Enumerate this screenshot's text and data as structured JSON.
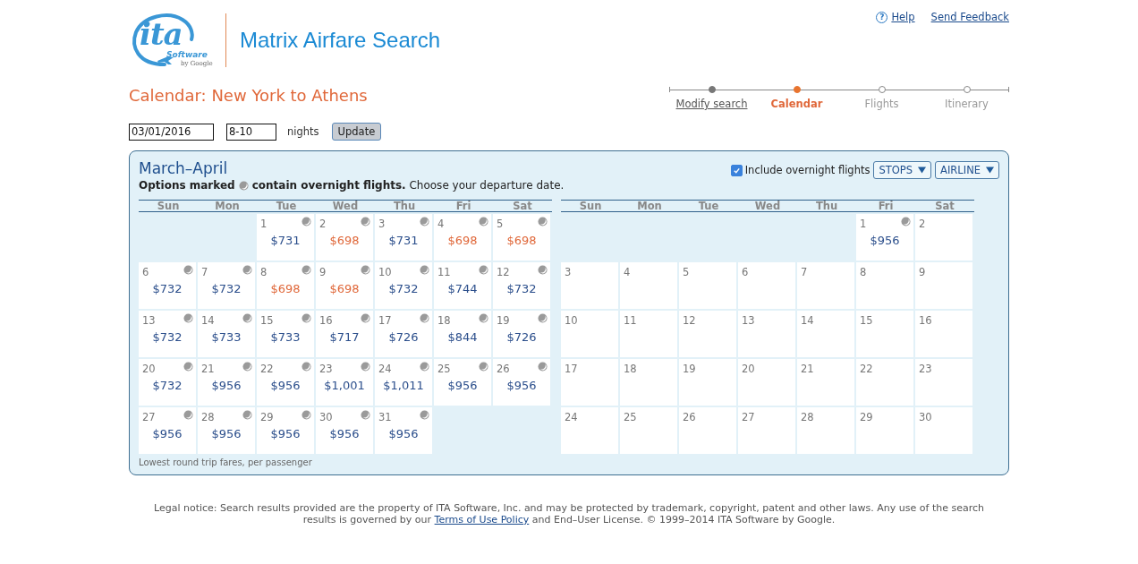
{
  "logo": {
    "mark": "ita",
    "word": "Software",
    "by": "by Google"
  },
  "app_title": "Matrix Airfare Search",
  "header_links": {
    "help_icon": "?",
    "help": "Help",
    "feedback": "Send Feedback"
  },
  "page_title": "Calendar: New York to Athens",
  "steps": [
    {
      "label": "Modify search",
      "selected": false,
      "visited": true
    },
    {
      "label": "Calendar",
      "selected": true,
      "visited": true
    },
    {
      "label": "Flights",
      "selected": false,
      "visited": false
    },
    {
      "label": "Itinerary",
      "selected": false,
      "visited": false
    }
  ],
  "search": {
    "date": "03/01/2016",
    "nights": "8-10",
    "nights_label": "nights",
    "button": "Update"
  },
  "calendar": {
    "title": "March–April",
    "legend_lead": "Options marked",
    "legend_rest": "**contain overnight flights.** Choose your departure date.",
    "overnight_option": {
      "label": "Include overnight flights",
      "checked": true
    },
    "filters": [
      "STOPS",
      "AIRLINE"
    ],
    "footnote": "Lowest round trip fares, per passenger",
    "months": [
      {
        "weekdays": [
          "Sun",
          "Mon",
          "Tue",
          "Wed",
          "Thu",
          "Fri",
          "Sat"
        ],
        "cells": [
          {
            "kind": "blank"
          },
          {
            "kind": "blank"
          },
          {
            "kind": "day",
            "day": "1",
            "price": "$731",
            "cheapest": false,
            "overnight": true
          },
          {
            "kind": "day",
            "day": "2",
            "price": "$698",
            "cheapest": true,
            "overnight": true
          },
          {
            "kind": "day",
            "day": "3",
            "price": "$731",
            "cheapest": false,
            "overnight": true
          },
          {
            "kind": "day",
            "day": "4",
            "price": "$698",
            "cheapest": true,
            "overnight": true
          },
          {
            "kind": "day",
            "day": "5",
            "price": "$698",
            "cheapest": true,
            "overnight": true
          },
          {
            "kind": "day",
            "day": "6",
            "price": "$732",
            "cheapest": false,
            "overnight": true
          },
          {
            "kind": "day",
            "day": "7",
            "price": "$732",
            "cheapest": false,
            "overnight": true
          },
          {
            "kind": "day",
            "day": "8",
            "price": "$698",
            "cheapest": true,
            "overnight": true
          },
          {
            "kind": "day",
            "day": "9",
            "price": "$698",
            "cheapest": true,
            "overnight": true
          },
          {
            "kind": "day",
            "day": "10",
            "price": "$732",
            "cheapest": false,
            "overnight": true
          },
          {
            "kind": "day",
            "day": "11",
            "price": "$744",
            "cheapest": false,
            "overnight": true
          },
          {
            "kind": "day",
            "day": "12",
            "price": "$732",
            "cheapest": false,
            "overnight": true
          },
          {
            "kind": "day",
            "day": "13",
            "price": "$732",
            "cheapest": false,
            "overnight": true
          },
          {
            "kind": "day",
            "day": "14",
            "price": "$733",
            "cheapest": false,
            "overnight": true
          },
          {
            "kind": "day",
            "day": "15",
            "price": "$733",
            "cheapest": false,
            "overnight": true
          },
          {
            "kind": "day",
            "day": "16",
            "price": "$717",
            "cheapest": false,
            "overnight": true
          },
          {
            "kind": "day",
            "day": "17",
            "price": "$726",
            "cheapest": false,
            "overnight": true
          },
          {
            "kind": "day",
            "day": "18",
            "price": "$844",
            "cheapest": false,
            "overnight": true
          },
          {
            "kind": "day",
            "day": "19",
            "price": "$726",
            "cheapest": false,
            "overnight": true
          },
          {
            "kind": "day",
            "day": "20",
            "price": "$732",
            "cheapest": false,
            "overnight": true
          },
          {
            "kind": "day",
            "day": "21",
            "price": "$956",
            "cheapest": false,
            "overnight": true
          },
          {
            "kind": "day",
            "day": "22",
            "price": "$956",
            "cheapest": false,
            "overnight": true
          },
          {
            "kind": "day",
            "day": "23",
            "price": "$1,001",
            "cheapest": false,
            "overnight": true
          },
          {
            "kind": "day",
            "day": "24",
            "price": "$1,011",
            "cheapest": false,
            "overnight": true
          },
          {
            "kind": "day",
            "day": "25",
            "price": "$956",
            "cheapest": false,
            "overnight": true
          },
          {
            "kind": "day",
            "day": "26",
            "price": "$956",
            "cheapest": false,
            "overnight": true
          },
          {
            "kind": "day",
            "day": "27",
            "price": "$956",
            "cheapest": false,
            "overnight": true
          },
          {
            "kind": "day",
            "day": "28",
            "price": "$956",
            "cheapest": false,
            "overnight": true
          },
          {
            "kind": "day",
            "day": "29",
            "price": "$956",
            "cheapest": false,
            "overnight": true
          },
          {
            "kind": "day",
            "day": "30",
            "price": "$956",
            "cheapest": false,
            "overnight": true
          },
          {
            "kind": "day",
            "day": "31",
            "price": "$956",
            "cheapest": false,
            "overnight": true
          }
        ]
      },
      {
        "weekdays": [
          "Sun",
          "Mon",
          "Tue",
          "Wed",
          "Thu",
          "Fri",
          "Sat"
        ],
        "cells": [
          {
            "kind": "blank"
          },
          {
            "kind": "blank"
          },
          {
            "kind": "blank"
          },
          {
            "kind": "blank"
          },
          {
            "kind": "blank"
          },
          {
            "kind": "day",
            "day": "1",
            "price": "$956",
            "cheapest": false,
            "overnight": true
          },
          {
            "kind": "day",
            "day": "2",
            "overnight": false
          },
          {
            "kind": "day",
            "day": "3",
            "overnight": false
          },
          {
            "kind": "day",
            "day": "4",
            "overnight": false
          },
          {
            "kind": "day",
            "day": "5",
            "overnight": false
          },
          {
            "kind": "day",
            "day": "6",
            "overnight": false
          },
          {
            "kind": "day",
            "day": "7",
            "overnight": false
          },
          {
            "kind": "day",
            "day": "8",
            "overnight": false
          },
          {
            "kind": "day",
            "day": "9",
            "overnight": false
          },
          {
            "kind": "day",
            "day": "10",
            "overnight": false
          },
          {
            "kind": "day",
            "day": "11",
            "overnight": false
          },
          {
            "kind": "day",
            "day": "12",
            "overnight": false
          },
          {
            "kind": "day",
            "day": "13",
            "overnight": false
          },
          {
            "kind": "day",
            "day": "14",
            "overnight": false
          },
          {
            "kind": "day",
            "day": "15",
            "overnight": false
          },
          {
            "kind": "day",
            "day": "16",
            "overnight": false
          },
          {
            "kind": "day",
            "day": "17",
            "overnight": false
          },
          {
            "kind": "day",
            "day": "18",
            "overnight": false
          },
          {
            "kind": "day",
            "day": "19",
            "overnight": false
          },
          {
            "kind": "day",
            "day": "20",
            "overnight": false
          },
          {
            "kind": "day",
            "day": "21",
            "overnight": false
          },
          {
            "kind": "day",
            "day": "22",
            "overnight": false
          },
          {
            "kind": "day",
            "day": "23",
            "overnight": false
          },
          {
            "kind": "day",
            "day": "24",
            "overnight": false
          },
          {
            "kind": "day",
            "day": "25",
            "overnight": false
          },
          {
            "kind": "day",
            "day": "26",
            "overnight": false
          },
          {
            "kind": "day",
            "day": "27",
            "overnight": false
          },
          {
            "kind": "day",
            "day": "28",
            "overnight": false
          },
          {
            "kind": "day",
            "day": "29",
            "overnight": false
          },
          {
            "kind": "day",
            "day": "30",
            "overnight": false
          }
        ]
      }
    ]
  },
  "legal": {
    "before": "Legal notice: Search results provided are the property of ITA Software, Inc. and may be protected by trademark, copyright, patent and other laws. Any use of the search results is governed by our ",
    "link": "Terms of Use Policy",
    "after": " and End–User License. © 1999–2014 ITA Software by Google."
  }
}
